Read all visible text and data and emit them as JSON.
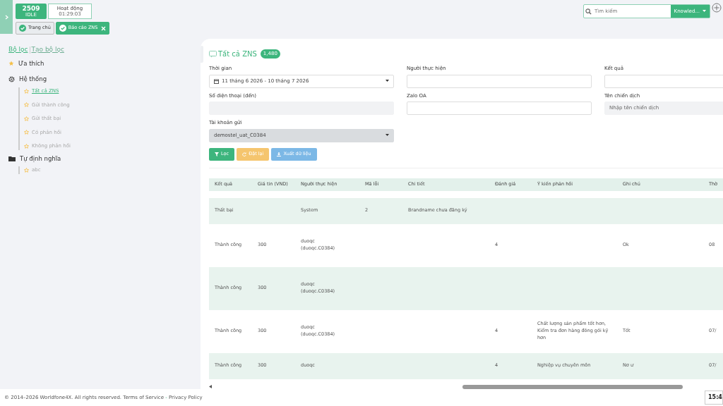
{
  "header": {
    "status": {
      "code": "2509",
      "state": "IDLE"
    },
    "activity": {
      "label": "Hoạt động",
      "timer": "01:29:03"
    },
    "tabs": [
      {
        "label": "Trang chủ",
        "selected": false,
        "closable": false
      },
      {
        "label": "Báo cáo ZNS",
        "selected": true,
        "closable": true
      }
    ],
    "search": {
      "placeholder": "Tìm kiếm",
      "scope": "Knowled..."
    }
  },
  "sidebar": {
    "tabs": [
      {
        "label": "Bộ lọc",
        "selected": true
      },
      {
        "label": "Tạo bộ lọc",
        "selected": false
      }
    ],
    "groups": [
      {
        "label": "Ưa thích",
        "kind": "favorites"
      },
      {
        "label": "Hệ thống",
        "kind": "system",
        "children": [
          {
            "label": "Tất cả ZNS",
            "selected": true
          },
          {
            "label": "Gửi thành công",
            "selected": false
          },
          {
            "label": "Gửi thất bại",
            "selected": false
          },
          {
            "label": "Có phản hồi",
            "selected": false
          },
          {
            "label": "Không phản hồi",
            "selected": false
          }
        ]
      },
      {
        "label": "Tự định nghĩa",
        "kind": "custom",
        "children": [
          {
            "label": "abc",
            "selected": false
          }
        ]
      }
    ]
  },
  "main": {
    "title": "Tất cả ZNS",
    "count": "1,480",
    "filters": [
      {
        "label": "Thời gian",
        "kind": "daterange",
        "value": "11 tháng 6 2026 - 10 tháng 7 2026"
      },
      {
        "label": "Người thực hiện",
        "kind": "input"
      },
      {
        "label": "Kết quả",
        "kind": "input"
      },
      {
        "label": "Số điện thoại (đến)",
        "kind": "readonly"
      },
      {
        "label": "Zalo OA",
        "kind": "input"
      },
      {
        "label": "Tên chiến dịch",
        "kind": "readonly",
        "placeholder": "Nhập tên chiến dịch"
      },
      {
        "label": "Tài khoản gửi",
        "kind": "select",
        "value": "demostel_uat_C0384"
      }
    ],
    "buttons": [
      {
        "label": "Lọc",
        "kind": "filter"
      },
      {
        "label": "Đặt lại",
        "kind": "reset"
      },
      {
        "label": "Xuất dữ liệu",
        "kind": "export"
      }
    ],
    "table": {
      "columns": [
        "Kết quả",
        "Giá tin (VND)",
        "Người thực hiện",
        "Mã lỗi",
        "Chi tiết",
        "Đánh giá",
        "Ý kiến phản hồi",
        "Ghi chú",
        "Thờ"
      ],
      "rows": [
        {
          "cells": [
            null,
            null,
            null,
            null,
            null,
            null,
            null,
            null,
            null
          ],
          "kind": "partial"
        },
        {
          "cells": [
            "Thất bại",
            null,
            "System",
            "2",
            "Brandname chưa đăng ký",
            null,
            null,
            null,
            null
          ],
          "kind": "short"
        },
        {
          "cells": [
            "Thành công",
            "300",
            "duoqc\n(duoqc.C0384)",
            null,
            null,
            "4",
            null,
            "Ok",
            "08"
          ],
          "kind": "tall"
        },
        {
          "cells": [
            "Thành công",
            "300",
            "duoqc\n(duoqc.C0384)",
            null,
            null,
            null,
            null,
            null,
            null
          ],
          "kind": "tall"
        },
        {
          "cells": [
            "Thành công",
            "300",
            "duoqc\n(duoqc.C0384)",
            null,
            null,
            "4",
            "Chất lượng sản phẩm tốt hơn, Kiểm tra đơn hàng đóng gói kỹ hơn",
            "Tốt",
            "07/"
          ],
          "kind": "tall"
        },
        {
          "cells": [
            "Thành công",
            "300",
            "duoqc",
            null,
            null,
            "4",
            "Nghiệp vụ chuyên môn",
            "Nơ ư",
            "07/"
          ],
          "kind": "cut"
        }
      ]
    }
  },
  "footer": {
    "copyright": "© 2014–2026",
    "brand": "Worldfone4X",
    "rights": ". All rights reserved.",
    "links": [
      "Terms of Service",
      "Privacy Policy"
    ],
    "separator": "-",
    "clock": "15:4"
  }
}
